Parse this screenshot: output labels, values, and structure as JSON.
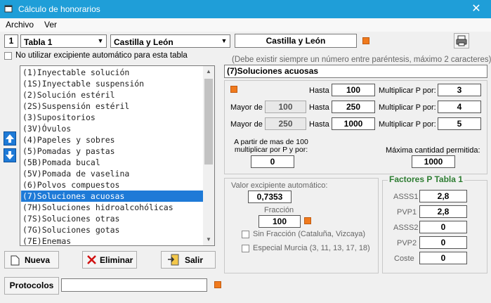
{
  "window": {
    "title": "Cálculo de honorarios",
    "close_label": "✕"
  },
  "menu": {
    "archivo": "Archivo",
    "ver": "Ver"
  },
  "toolbar": {
    "table_number": "1",
    "table_combo": "Tabla 1",
    "region_combo": "Castilla y León",
    "region_display": "Castilla y León"
  },
  "no_excipient": {
    "label": "No utilizar excipiente automático para esta tabla",
    "checked": false
  },
  "hint": "(Debe existir siempre un número entre paréntesis, máximo 2 caracteres)",
  "name_field": "(7)Soluciones acuosas",
  "list": {
    "items": [
      "(1)Inyectable solución",
      "(1S)Inyectable suspensión",
      "(2)Solución estéril",
      "(2S)Suspensión estéril",
      "(3)Supositorios",
      "(3V)Óvulos",
      "(4)Papeles y sobres",
      "(5)Pomadas y pastas",
      "(5B)Pomada bucal",
      "(5V)Pomada de vaselina",
      "(6)Polvos compuestos",
      "(7)Soluciones acuosas",
      "(7H)Soluciones hidroalcohólicas",
      "(7S)Soluciones otras",
      "(7G)Soluciones gotas",
      "(7E)Enemas"
    ],
    "selected_index": 11
  },
  "ranges": {
    "hasta_label": "Hasta",
    "mayor_label": "Mayor de",
    "multiplicar_label": "Multiplicar P por:",
    "rows": [
      {
        "mayor": "",
        "hasta": "100",
        "mult": "3"
      },
      {
        "mayor": "100",
        "hasta": "250",
        "mult": "4"
      },
      {
        "mayor": "250",
        "hasta": "1000",
        "mult": "5"
      }
    ],
    "a_partir_label": "A partir de mas de 100 multiplicar por P y por:",
    "a_partir_value": "0",
    "maxima_label": "Máxima cantidad permitida:",
    "maxima_value": "1000"
  },
  "excipiente": {
    "label": "Valor excipiente automático:",
    "value": "0,7353",
    "fraccion_label": "Fracción",
    "fraccion_value": "100",
    "sin_fraccion_label": "Sin Fracción (Cataluña, Vizcaya)",
    "especial_murcia_label": "Especial Murcia (3, 11, 13, 17, 18)"
  },
  "factores": {
    "title": "Factores P Tabla 1",
    "rows": [
      {
        "label": "ASSS1",
        "value": "2,8"
      },
      {
        "label": "PVP1",
        "value": "2,8"
      },
      {
        "label": "ASSS2",
        "value": "0"
      },
      {
        "label": "PVP2",
        "value": "0"
      },
      {
        "label": "Coste",
        "value": "0"
      }
    ]
  },
  "buttons": {
    "nueva": "Nueva",
    "eliminar": "Eliminar",
    "salir": "Salir",
    "protocolos": "Protocolos"
  },
  "protocolos_field": "",
  "colors": {
    "titlebar": "#1f9ed8",
    "selection": "#1e7ad7",
    "accent": "#f07a1d",
    "factores_title": "#2e7d32"
  }
}
